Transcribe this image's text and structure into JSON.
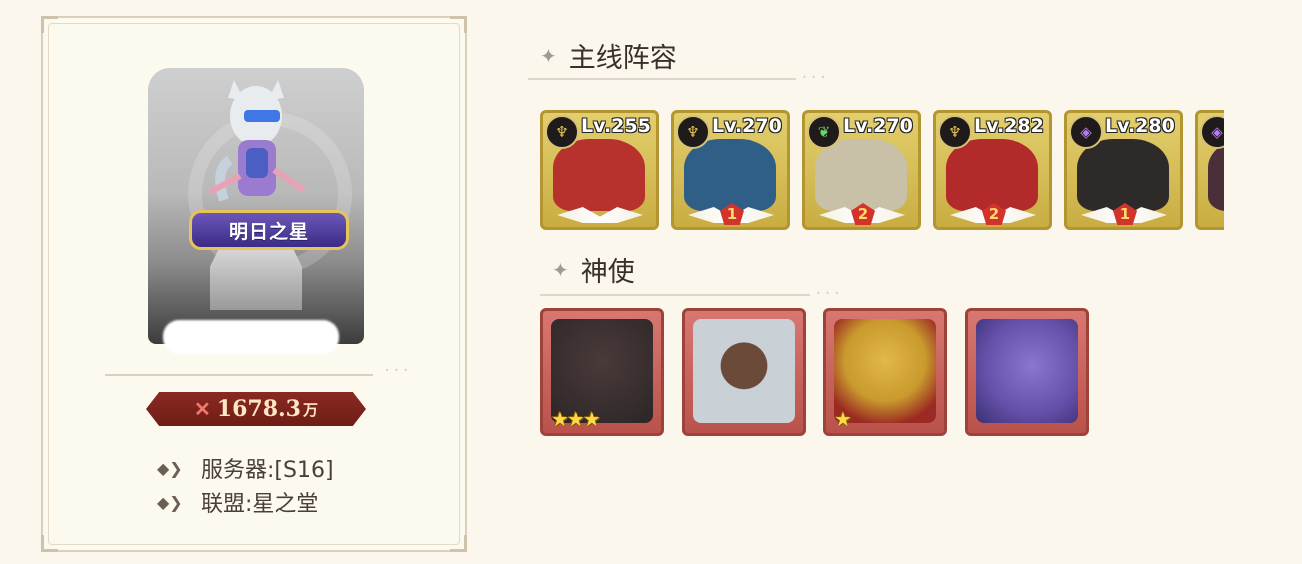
{
  "profile": {
    "title_badge": "明日之星",
    "power": "1678.3",
    "power_unit": "万",
    "server_label": "服务器:[S16]",
    "alliance_label": "联盟:星之堂"
  },
  "sections": {
    "lineup_title": "主线阵容",
    "spirit_title": "神使"
  },
  "heroes": [
    {
      "level": "Lv.255",
      "element": "dark-flame-icon",
      "stars": "",
      "face_color": "#b7322c"
    },
    {
      "level": "Lv.270",
      "element": "dark-flame-icon",
      "stars": "1",
      "face_color": "#2f5f87"
    },
    {
      "level": "Lv.270",
      "element": "nature-icon",
      "stars": "2",
      "face_color": "#c9c0a8"
    },
    {
      "level": "Lv.282",
      "element": "dark-flame-icon",
      "stars": "2",
      "face_color": "#b32a2a"
    },
    {
      "level": "Lv.280",
      "element": "void-icon",
      "stars": "1",
      "face_color": "#2e2a2a"
    },
    {
      "level": "",
      "element": "void-icon",
      "stars": "",
      "face_color": "#4a2f3a"
    }
  ],
  "spirits": [
    {
      "name": "dark-dragon",
      "rank": "★★★",
      "art_color": "#2c2626"
    },
    {
      "name": "silver-haired-girl",
      "rank": "",
      "art_color": "#c9d1d6"
    },
    {
      "name": "golden-helm-knight",
      "rank": "★",
      "art_color": "#c99a2e"
    },
    {
      "name": "violet-dragon",
      "rank": "",
      "art_color": "#6450a8"
    }
  ],
  "colors": {
    "hero_frame": "#c9ad42",
    "spirit_frame": "#b9524b",
    "power_bg": "#7a231c",
    "page_bg": "#fbf7ec"
  }
}
